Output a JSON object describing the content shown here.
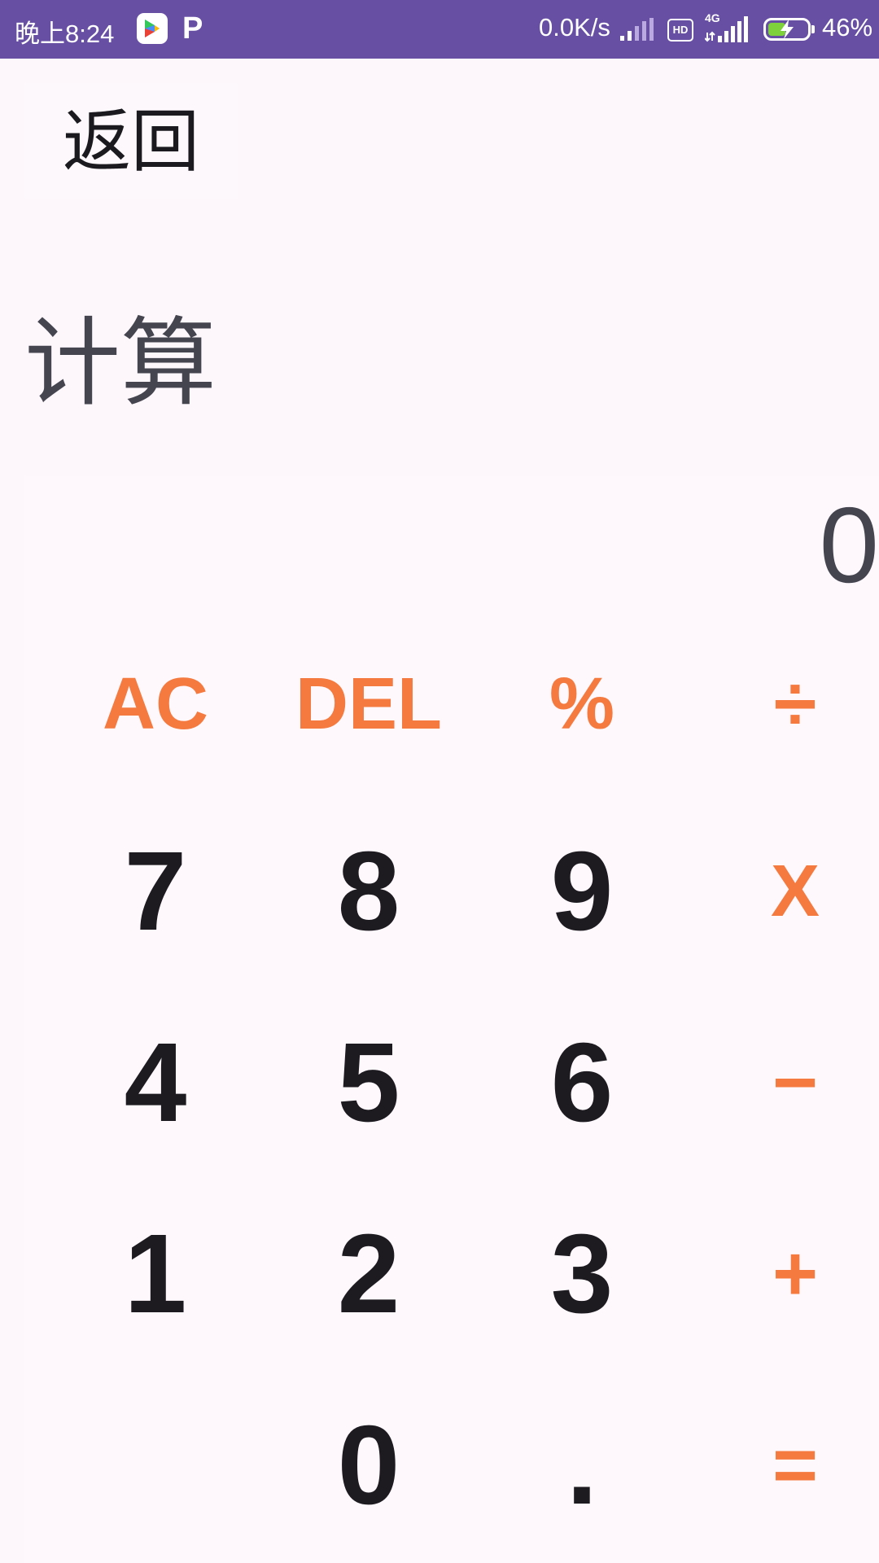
{
  "status_bar": {
    "time": "晚上8:24",
    "net_speed": "0.0K/s",
    "hd": "HD",
    "network": "4G",
    "battery_percent": "46%",
    "battery_level": 0.46,
    "accent": "#6750a4"
  },
  "toolbar": {
    "back_label": "返回"
  },
  "page": {
    "title": "计算"
  },
  "calculator": {
    "display_value": "0",
    "keys": {
      "ac": "AC",
      "del": "DEL",
      "percent": "%",
      "divide": "÷",
      "seven": "7",
      "eight": "8",
      "nine": "9",
      "multiply": "X",
      "four": "4",
      "five": "5",
      "six": "6",
      "minus": "−",
      "one": "1",
      "two": "2",
      "three": "3",
      "plus": "+",
      "zero": "0",
      "dot": ".",
      "equals": "="
    },
    "colors": {
      "operator": "#f47a3f",
      "digit": "#1d1b20"
    }
  }
}
